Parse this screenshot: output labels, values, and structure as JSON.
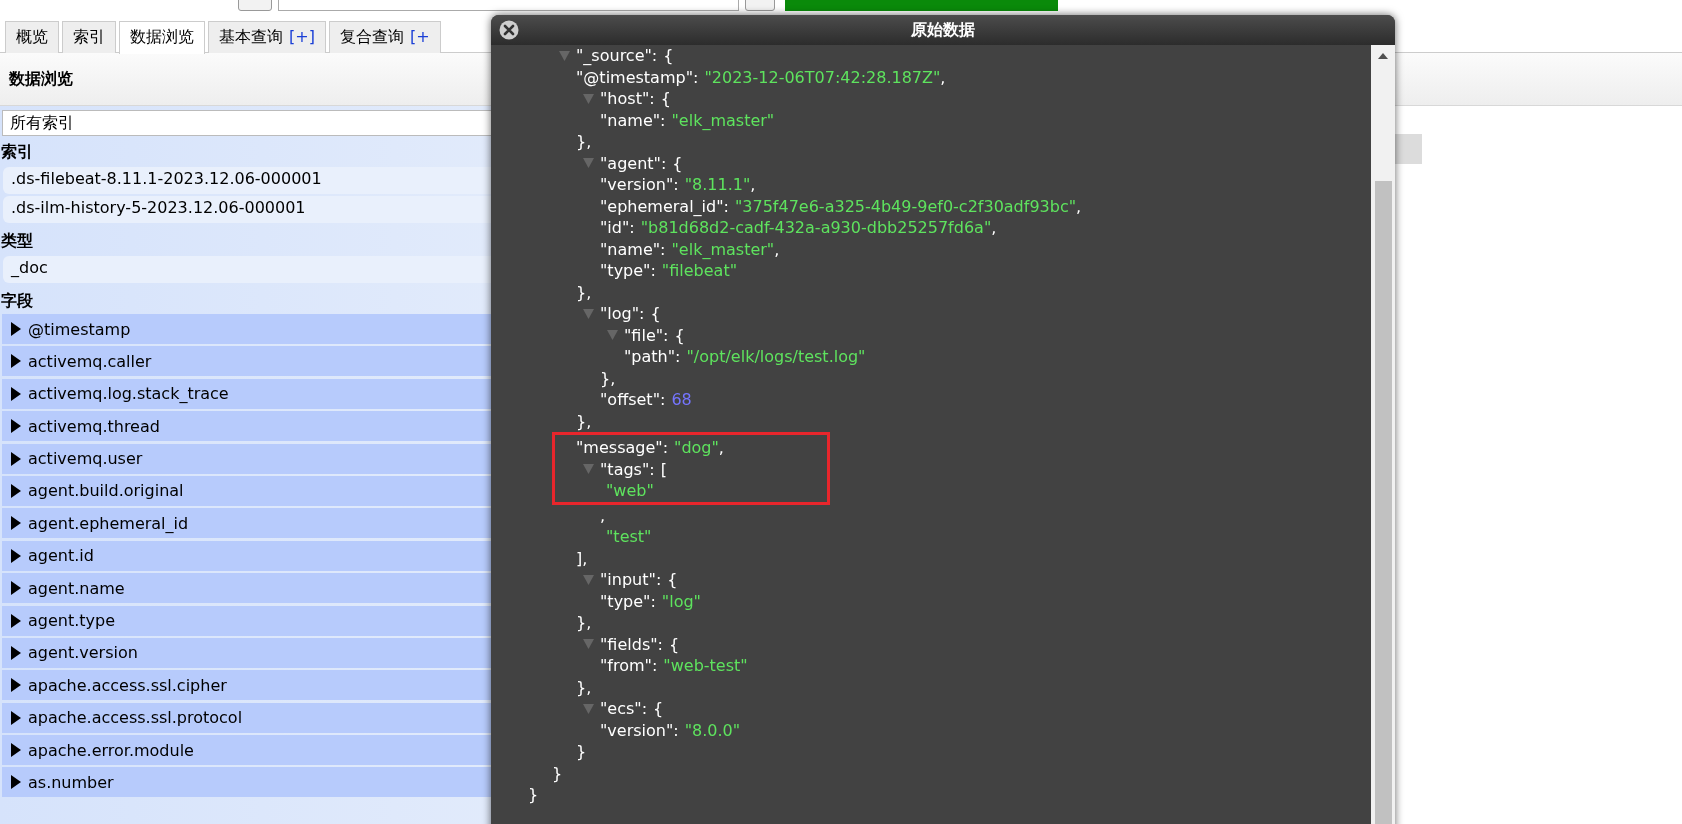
{
  "tabs": [
    {
      "label": "概览",
      "selected": false
    },
    {
      "label": "索引",
      "selected": false
    },
    {
      "label": "数据浏览",
      "selected": true
    },
    {
      "label": "基本查询",
      "extra": "[+]",
      "selected": false
    },
    {
      "label": "复合查询",
      "extra": "[+",
      "selected": false
    }
  ],
  "page_title": "数据浏览",
  "sidebar": {
    "index_select": {
      "value": "所有索引"
    },
    "sections": [
      {
        "title": "索引",
        "kind": "plain",
        "items": [
          ".ds-filebeat-8.11.1-2023.12.06-000001",
          ".ds-ilm-history-5-2023.12.06-000001"
        ]
      },
      {
        "title": "类型",
        "kind": "plain",
        "items": [
          "_doc"
        ]
      },
      {
        "title": "字段",
        "kind": "field",
        "items": [
          "@timestamp",
          "activemq.caller",
          "activemq.log.stack_trace",
          "activemq.thread",
          "activemq.user",
          "agent.build.original",
          "agent.ephemeral_id",
          "agent.id",
          "agent.name",
          "agent.type",
          "agent.version",
          "apache.access.ssl.cipher",
          "apache.access.ssl.protocol",
          "apache.error.module",
          "as.number"
        ]
      }
    ]
  },
  "dialog": {
    "title": "原始数据",
    "document": {
      "close": "}",
      "children": [
        {
          "key": "\"_source\":",
          "open": "{",
          "expanded": true,
          "highlighted": false,
          "close": "}",
          "children": [
            {
              "key": "\"@timestamp\":",
              "value": "\"2023-12-06T07:42:28.187Z\"",
              "kind": "string",
              "tail": ",",
              "highlighted": false
            },
            {
              "key": "\"host\":",
              "open": "{",
              "expanded": true,
              "highlighted": false,
              "close": "},",
              "children": [
                {
                  "key": "\"name\":",
                  "value": "\"elk_master\"",
                  "kind": "string",
                  "highlighted": false
                }
              ]
            },
            {
              "key": "\"agent\":",
              "open": "{",
              "expanded": true,
              "highlighted": false,
              "close": "},",
              "children": [
                {
                  "key": "\"version\":",
                  "value": "\"8.11.1\"",
                  "kind": "string",
                  "tail": ",",
                  "highlighted": false
                },
                {
                  "key": "\"ephemeral_id\":",
                  "value": "\"375f47e6-a325-4b49-9ef0-c2f30adf93bc\"",
                  "kind": "string",
                  "tail": ",",
                  "highlighted": false
                },
                {
                  "key": "\"id\":",
                  "value": "\"b81d68d2-cadf-432a-a930-dbb25257fd6a\"",
                  "kind": "string",
                  "tail": ",",
                  "highlighted": false
                },
                {
                  "key": "\"name\":",
                  "value": "\"elk_master\"",
                  "kind": "string",
                  "tail": ",",
                  "highlighted": false
                },
                {
                  "key": "\"type\":",
                  "value": "\"filebeat\"",
                  "kind": "string",
                  "highlighted": false
                }
              ]
            },
            {
              "key": "\"log\":",
              "open": "{",
              "expanded": true,
              "highlighted": false,
              "close": "},",
              "children": [
                {
                  "key": "\"file\":",
                  "open": "{",
                  "expanded": true,
                  "highlighted": false,
                  "close": "},",
                  "children": [
                    {
                      "key": "\"path\":",
                      "value": "\"/opt/elk/logs/test.log\"",
                      "kind": "string",
                      "highlighted": false
                    }
                  ]
                },
                {
                  "key": "\"offset\":",
                  "value": "68",
                  "kind": "number",
                  "highlighted": false
                }
              ]
            },
            {
              "key": "\"message\":",
              "value": "\"dog\"",
              "kind": "string",
              "tail": ",",
              "highlighted": true
            },
            {
              "key": "\"tags\":",
              "open": "[",
              "expanded": true,
              "highlighted": true,
              "close": "],",
              "children": [
                {
                  "value": "\"web\"",
                  "kind": "string",
                  "highlighted": true
                },
                {
                  "value": ",",
                  "kind": "punct",
                  "highlighted": false
                },
                {
                  "value": "\"test\"",
                  "kind": "string",
                  "highlighted": false
                }
              ]
            },
            {
              "key": "\"input\":",
              "open": "{",
              "expanded": true,
              "highlighted": false,
              "close": "},",
              "children": [
                {
                  "key": "\"type\":",
                  "value": "\"log\"",
                  "kind": "string",
                  "highlighted": false
                }
              ]
            },
            {
              "key": "\"fields\":",
              "open": "{",
              "expanded": true,
              "highlighted": false,
              "close": "},",
              "children": [
                {
                  "key": "\"from\":",
                  "value": "\"web-test\"",
                  "kind": "string",
                  "highlighted": false
                }
              ]
            },
            {
              "key": "\"ecs\":",
              "open": "{",
              "expanded": true,
              "highlighted": false,
              "close": "}",
              "children": [
                {
                  "key": "\"version\":",
                  "value": "\"8.0.0\"",
                  "kind": "string",
                  "highlighted": false
                }
              ]
            }
          ]
        }
      ]
    }
  }
}
